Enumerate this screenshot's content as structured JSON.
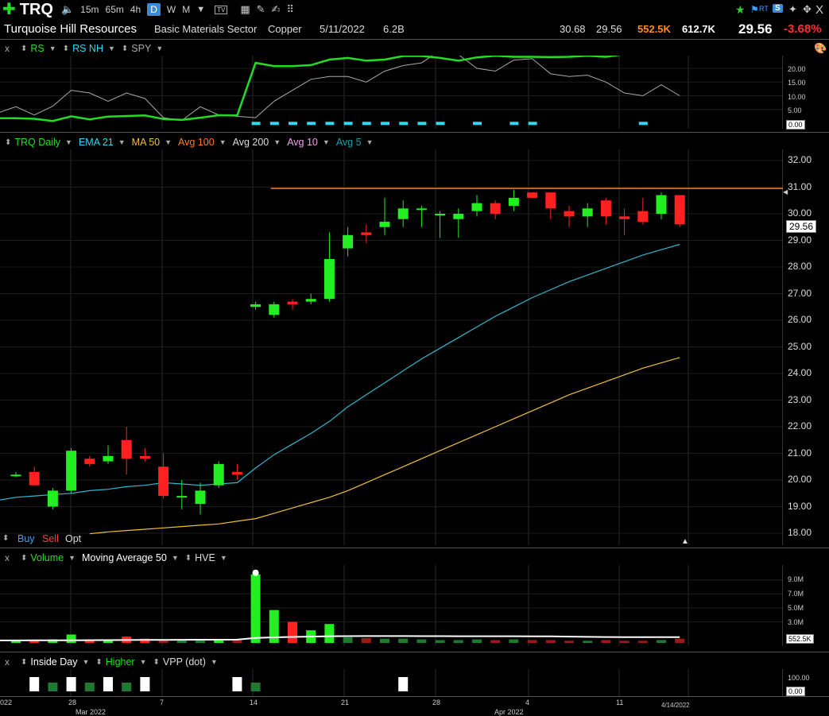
{
  "toolbar": {
    "symbol": "TRQ",
    "timeframes": [
      "15m",
      "65m",
      "4h",
      "D",
      "W",
      "M"
    ],
    "active_timeframe": "D",
    "rt_label": "RT",
    "s_label": "S",
    "close": "X"
  },
  "info": {
    "company": "Turquoise Hill Resources",
    "sector": "Basic Materials Sector",
    "industry": "Copper",
    "date": "5/11/2022",
    "market_cap": "6.2B",
    "high": "30.68",
    "low": "29.56",
    "volume": "552.5K",
    "avg_volume": "612.7K",
    "last": "29.56",
    "change": "-3.68%"
  },
  "rs_pane": {
    "close": "x",
    "legend": [
      {
        "label": "RS",
        "color": "#22dd22"
      },
      {
        "label": "RS NH",
        "color": "#30d8f0"
      },
      {
        "label": "SPY",
        "color": "#aaaaaa"
      }
    ],
    "ticks": [
      "20.00",
      "15.00",
      "10.00",
      "5.00"
    ],
    "value_box": "0.00"
  },
  "price_pane": {
    "legend": [
      {
        "label": "TRQ Daily",
        "color": "#22dd22"
      },
      {
        "label": "EMA 21",
        "color": "#30d8f0"
      },
      {
        "label": "MA 50",
        "color": "#f0c030"
      },
      {
        "label": "Avg 100",
        "color": "#ff7b20"
      },
      {
        "label": "Avg 200",
        "color": "#dddddd"
      },
      {
        "label": "Avg 10",
        "color": "#f0a0f0"
      },
      {
        "label": "Avg 5",
        "color": "#1a9fa8"
      }
    ],
    "ticks": [
      "32.00",
      "31.00",
      "30.00",
      "29.00",
      "28.00",
      "27.00",
      "26.00",
      "25.00",
      "24.00",
      "23.00",
      "22.00",
      "21.00",
      "20.00",
      "19.00",
      "18.00"
    ],
    "last_box": "29.56",
    "buy": "Buy",
    "sell": "Sell",
    "opt": "Opt"
  },
  "volume_pane": {
    "close": "x",
    "legend": [
      {
        "label": "Volume",
        "color": "#22dd22"
      },
      {
        "label": "Moving Average 50",
        "color": "#ffffff"
      },
      {
        "label": "HVE",
        "color": "#dddddd"
      }
    ],
    "ticks": [
      "9.0M",
      "7.0M",
      "5.0M",
      "3.0M"
    ],
    "value_box": "552.5K"
  },
  "pattern_pane": {
    "close": "x",
    "legend": [
      {
        "label": "Inside Day",
        "color": "#ffffff"
      },
      {
        "label": "Higher",
        "color": "#22dd22"
      },
      {
        "label": "VPP (dot)",
        "color": "#dddddd"
      }
    ],
    "ticks": [
      "100.00"
    ],
    "value_box": "0.00"
  },
  "date_axis": {
    "labels": [
      "28",
      "7",
      "14",
      "21",
      "28",
      "4",
      "11"
    ],
    "months": [
      "Mar 2022",
      "Apr 2022"
    ],
    "left_fragment": "022",
    "current_date": "4/14/2022"
  },
  "chart_data": {
    "type": "candlestick",
    "candles": [
      {
        "o": 20.2,
        "h": 20.3,
        "l": 20.1,
        "c": 20.2
      },
      {
        "o": 20.3,
        "h": 20.5,
        "l": 19.8,
        "c": 19.8
      },
      {
        "o": 19.0,
        "h": 19.7,
        "l": 18.9,
        "c": 19.6
      },
      {
        "o": 19.6,
        "h": 21.2,
        "l": 19.5,
        "c": 21.1
      },
      {
        "o": 20.8,
        "h": 20.9,
        "l": 20.5,
        "c": 20.6
      },
      {
        "o": 20.7,
        "h": 21.3,
        "l": 20.6,
        "c": 20.9
      },
      {
        "o": 21.5,
        "h": 22.0,
        "l": 20.2,
        "c": 20.8
      },
      {
        "o": 20.9,
        "h": 21.2,
        "l": 20.7,
        "c": 20.8
      },
      {
        "o": 20.5,
        "h": 21.0,
        "l": 19.3,
        "c": 19.4
      },
      {
        "o": 19.4,
        "h": 20.0,
        "l": 18.9,
        "c": 19.4
      },
      {
        "o": 19.1,
        "h": 19.9,
        "l": 18.7,
        "c": 19.6
      },
      {
        "o": 19.8,
        "h": 20.7,
        "l": 19.7,
        "c": 20.6
      },
      {
        "o": 20.3,
        "h": 20.6,
        "l": 20.0,
        "c": 20.2
      },
      {
        "o": 26.5,
        "h": 26.7,
        "l": 26.4,
        "c": 26.6
      },
      {
        "o": 26.2,
        "h": 26.7,
        "l": 26.1,
        "c": 26.6
      },
      {
        "o": 26.7,
        "h": 26.8,
        "l": 26.4,
        "c": 26.6
      },
      {
        "o": 26.7,
        "h": 27.0,
        "l": 26.6,
        "c": 26.8
      },
      {
        "o": 26.8,
        "h": 29.3,
        "l": 26.7,
        "c": 28.3
      },
      {
        "o": 28.7,
        "h": 29.5,
        "l": 28.4,
        "c": 29.2
      },
      {
        "o": 29.3,
        "h": 29.6,
        "l": 28.9,
        "c": 29.2
      },
      {
        "o": 29.5,
        "h": 30.6,
        "l": 29.2,
        "c": 29.7
      },
      {
        "o": 29.8,
        "h": 30.5,
        "l": 29.5,
        "c": 30.2
      },
      {
        "o": 30.2,
        "h": 30.3,
        "l": 29.5,
        "c": 30.2
      },
      {
        "o": 30.0,
        "h": 30.1,
        "l": 29.1,
        "c": 30.0
      },
      {
        "o": 29.8,
        "h": 30.2,
        "l": 29.1,
        "c": 30.0
      },
      {
        "o": 30.1,
        "h": 30.7,
        "l": 29.9,
        "c": 30.4
      },
      {
        "o": 30.4,
        "h": 30.5,
        "l": 29.8,
        "c": 30.0
      },
      {
        "o": 30.3,
        "h": 30.9,
        "l": 30.1,
        "c": 30.6
      },
      {
        "o": 30.8,
        "h": 30.8,
        "l": 30.6,
        "c": 30.6
      },
      {
        "o": 30.8,
        "h": 30.8,
        "l": 29.8,
        "c": 30.2
      },
      {
        "o": 30.1,
        "h": 30.3,
        "l": 29.5,
        "c": 29.9
      },
      {
        "o": 29.9,
        "h": 30.4,
        "l": 29.5,
        "c": 30.2
      },
      {
        "o": 30.5,
        "h": 30.6,
        "l": 29.6,
        "c": 29.9
      },
      {
        "o": 29.9,
        "h": 30.2,
        "l": 29.2,
        "c": 29.8
      },
      {
        "o": 30.1,
        "h": 30.6,
        "l": 29.6,
        "c": 29.7
      },
      {
        "o": 30.0,
        "h": 30.8,
        "l": 29.8,
        "c": 30.7
      },
      {
        "o": 30.7,
        "h": 30.7,
        "l": 29.5,
        "c": 29.6
      }
    ],
    "ema21": [
      19.35,
      19.4,
      19.45,
      19.5,
      19.6,
      19.65,
      19.75,
      19.8,
      19.9,
      19.85,
      19.8,
      19.85,
      19.9,
      20.45,
      20.95,
      21.35,
      21.75,
      22.2,
      22.75,
      23.2,
      23.65,
      24.1,
      24.55,
      24.95,
      25.35,
      25.75,
      26.15,
      26.5,
      26.85,
      27.15,
      27.45,
      27.7,
      27.95,
      28.2,
      28.45,
      28.65,
      28.85
    ],
    "ma50": [
      17.75,
      17.8,
      17.85,
      17.9,
      17.98,
      18.05,
      18.1,
      18.15,
      18.2,
      18.25,
      18.3,
      18.35,
      18.45,
      18.55,
      18.75,
      18.95,
      19.15,
      19.35,
      19.6,
      19.9,
      20.2,
      20.5,
      20.8,
      21.1,
      21.4,
      21.7,
      22.0,
      22.3,
      22.6,
      22.9,
      23.2,
      23.45,
      23.7,
      23.95,
      24.2,
      24.4,
      24.6
    ],
    "avg100_level": 30.95,
    "avg100_from_index": 14,
    "volume": [
      0.4,
      0.4,
      0.5,
      1.2,
      0.5,
      0.5,
      0.9,
      0.6,
      0.4,
      0.4,
      0.4,
      0.5,
      0.4,
      9.8,
      4.7,
      3.0,
      1.8,
      2.7,
      0.8,
      0.7,
      0.6,
      0.6,
      0.5,
      0.4,
      0.4,
      0.5,
      0.4,
      0.5,
      0.4,
      0.4,
      0.3,
      0.3,
      0.4,
      0.3,
      0.3,
      0.4,
      0.6
    ],
    "volume_ma50": [
      0.35,
      0.36,
      0.37,
      0.38,
      0.39,
      0.4,
      0.41,
      0.42,
      0.43,
      0.44,
      0.45,
      0.46,
      0.47,
      0.7,
      0.8,
      0.85,
      0.9,
      0.95,
      0.97,
      0.98,
      0.98,
      0.98,
      0.97,
      0.97,
      0.96,
      0.96,
      0.95,
      0.95,
      0.94,
      0.94,
      0.9,
      0.86,
      0.84,
      0.82,
      0.82,
      0.82,
      0.83
    ],
    "rs": [
      1.8,
      1.6,
      0.8,
      2.5,
      1.4,
      2.4,
      2.6,
      2.8,
      1.5,
      1.2,
      2.0,
      2.9,
      2.8,
      22.0,
      20.8,
      20.8,
      21.2,
      23.2,
      23.8,
      22.8,
      23.2,
      24.5,
      24.5,
      23.8,
      22.8,
      24.0,
      24.6,
      24.2,
      24.2,
      24.1,
      24.2,
      24.6,
      24.2,
      25.2,
      25.2,
      26.5,
      25.0
    ],
    "spy": [
      6.0,
      3.0,
      6.2,
      12.0,
      11.0,
      8.0,
      11.0,
      9.0,
      2.0,
      1.0,
      6.0,
      3.0,
      2.5,
      2.0,
      8.0,
      12.0,
      16.0,
      17.0,
      17.0,
      15.0,
      19.0,
      21.0,
      22.0,
      26.5,
      25.0,
      20.0,
      19.0,
      23.0,
      23.5,
      18.0,
      17.0,
      17.5,
      15.0,
      11.0,
      10.0,
      14.0,
      10.0
    ],
    "rs_nh_indices": [
      13,
      14,
      15,
      16,
      17,
      18,
      19,
      20,
      21,
      22,
      23,
      25,
      27,
      28,
      34
    ],
    "inside_day_indices": [
      1,
      3,
      5,
      7,
      12,
      21
    ],
    "higher_indices": [
      2,
      4,
      6,
      13
    ]
  }
}
